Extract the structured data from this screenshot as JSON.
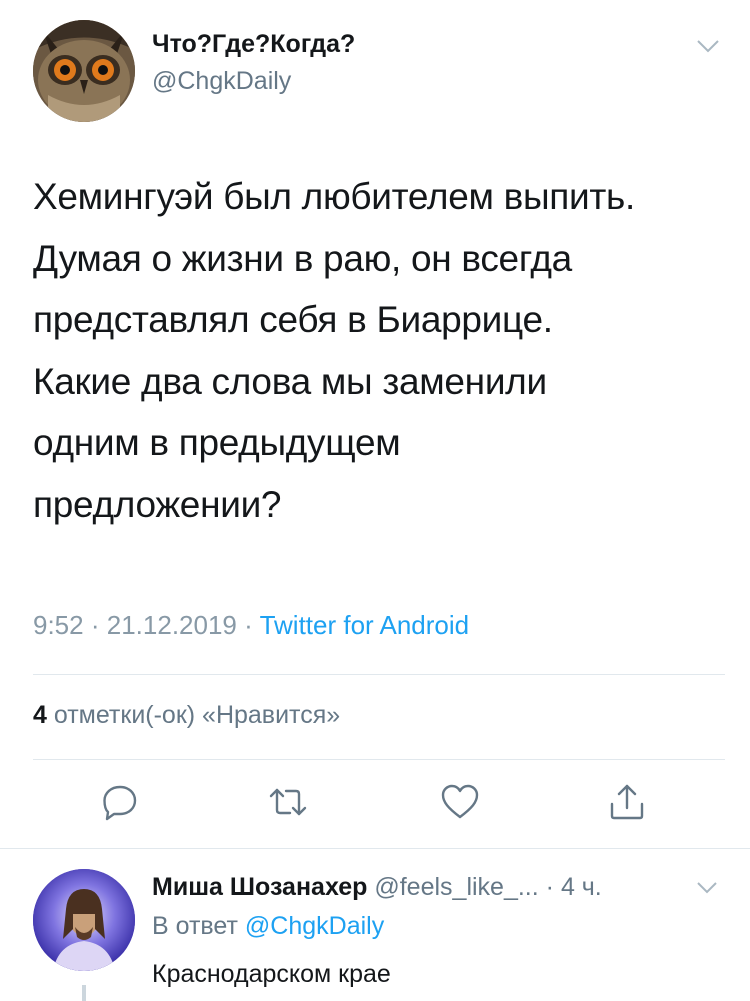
{
  "tweet": {
    "author_name": "Что?Где?Когда?",
    "author_handle": "@ChgkDaily",
    "text_lines": [
      "Хемингуэй был любителем выпить.",
      "Думая о жизни в раю, он всегда",
      "представлял себя в Биаррице.",
      "Какие два слова мы заменили",
      "одним в предыдущем",
      "предложении?"
    ],
    "time": "9:52",
    "date": "21.12.2019",
    "separator": "·",
    "source": "Twitter for Android",
    "likes_count": "4",
    "likes_label": "отметки(-ок) «Нравится»"
  },
  "actions": {
    "reply_icon": "reply-icon",
    "retweet_icon": "retweet-icon",
    "like_icon": "like-icon",
    "share_icon": "share-icon"
  },
  "reply": {
    "author_name": "Миша Шозанахер",
    "author_handle": "@feels_like_...",
    "separator": "·",
    "time_ago": "4 ч.",
    "reply_to_prefix": "В ответ",
    "reply_to_mention": "@ChgkDaily",
    "text": "Краснодарском крае"
  },
  "colors": {
    "accent": "#1da1f2",
    "secondary_text": "#657786",
    "divider": "#e1e8ed"
  }
}
